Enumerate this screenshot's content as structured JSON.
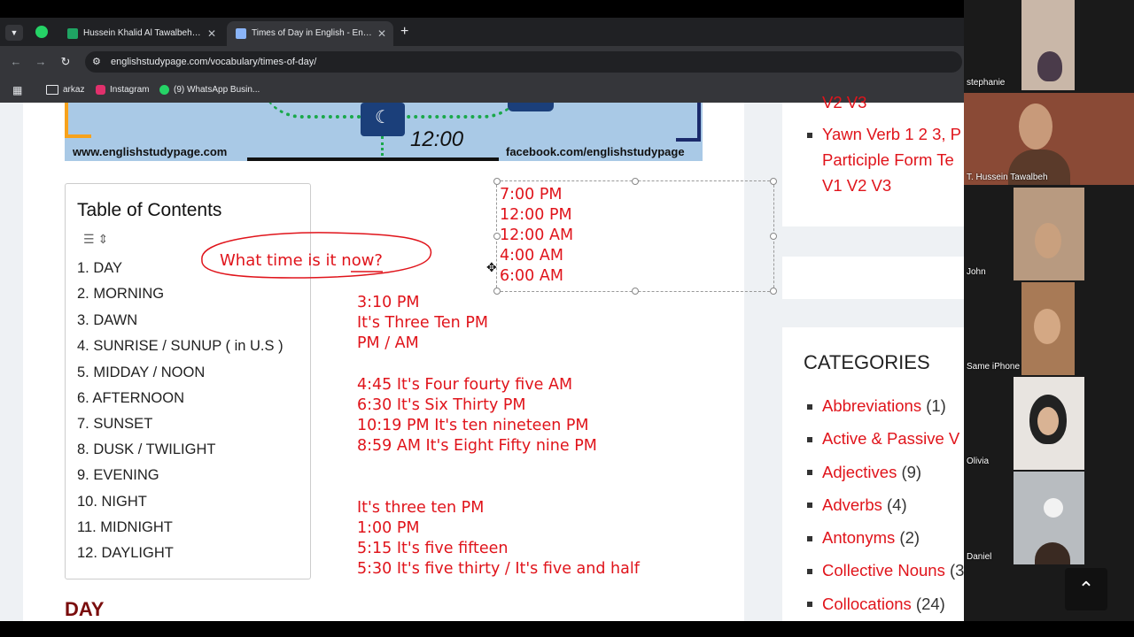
{
  "browser": {
    "tabs": [
      {
        "label": "Hussein Khalid Al Tawalbeh - Go",
        "icon": "sheets-icon",
        "icon_color": "#1fa463",
        "active": false
      },
      {
        "label": "Times of Day in English - English",
        "icon": "page-icon",
        "icon_color": "#8ab4f8",
        "active": true
      }
    ],
    "url": "englishstudypage.com/vocabulary/times-of-day/",
    "bookmarks": [
      "arkaz",
      "Instagram",
      "(9) WhatsApp Busin..."
    ]
  },
  "banner": {
    "time": "12:00",
    "left_text": "www.englishstudypage.com",
    "right_text": "facebook.com/englishstudypage"
  },
  "toc": {
    "title": "Table of Contents",
    "items": [
      "1. DAY",
      "2. MORNING",
      "3. DAWN",
      "4. SUNRISE / SUNUP ( in U.S )",
      "5. MIDDAY / NOON",
      "6. AFTERNOON",
      "7. SUNSET",
      "8. DUSK / TWILIGHT",
      "9. EVENING",
      "10. NIGHT",
      "11. MIDNIGHT",
      "12. DAYLIGHT"
    ]
  },
  "annotation": {
    "handwritten": "What time is it now?",
    "box_lines": [
      "7:00 PM",
      "12:00 PM",
      "12:00 AM",
      "4:00 AM",
      "6:00 AM"
    ],
    "block1": [
      "3:10 PM",
      "It's Three Ten PM",
      "PM / AM"
    ],
    "block2": [
      "4:45 It's Four fourty five AM",
      "6:30 It's Six Thirty PM",
      "10:19 PM It's ten nineteen PM",
      "8:59 AM It's Eight Fifty nine PM"
    ],
    "block3": [
      "It's three ten PM",
      "1:00 PM",
      "5:15 It's five fifteen",
      "5:30 It's five thirty / It's five and half"
    ]
  },
  "section_heading": "DAY",
  "sidebar": {
    "top_links": [
      "V2 V3",
      "Yawn Verb 1 2 3, P",
      "Participle Form Te",
      "V1 V2 V3"
    ],
    "categories_title": "CATEGORIES",
    "categories": [
      {
        "label": "Abbreviations",
        "count": "(1)"
      },
      {
        "label": "Active & Passive V",
        "count": ""
      },
      {
        "label": "Adjectives",
        "count": "(9)"
      },
      {
        "label": "Adverbs",
        "count": "(4)"
      },
      {
        "label": "Antonyms",
        "count": "(2)"
      },
      {
        "label": "Collective Nouns",
        "count": "(3)"
      },
      {
        "label": "Collocations",
        "count": "(24)"
      }
    ]
  },
  "video": {
    "participants": [
      "stephanie",
      "T. Hussein Tawalbeh",
      "John",
      "Same iPhone",
      "Olivia",
      "Daniel"
    ]
  },
  "colors": {
    "accent_red": "#e0141b",
    "heading_dark_red": "#7a0d0d"
  }
}
